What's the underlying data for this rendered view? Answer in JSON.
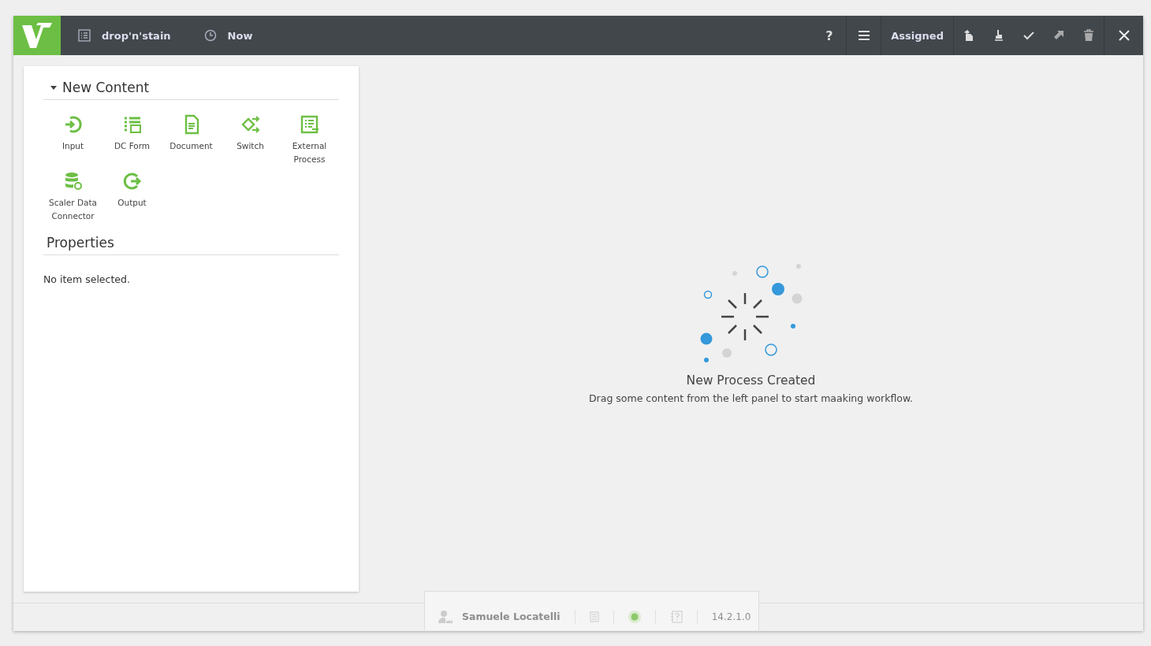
{
  "top_bar": {
    "process_name": "drop'n'stain",
    "time": "Now",
    "help": "?",
    "assignment": "Assigned"
  },
  "new_content": {
    "title": "New Content",
    "expanded": true,
    "items": [
      {
        "label": "Input"
      },
      {
        "label": "DC Form"
      },
      {
        "label": "Document"
      },
      {
        "label": "Switch"
      },
      {
        "label": "External Process"
      },
      {
        "label": "Scaler Data Connector"
      },
      {
        "label": "Output"
      }
    ]
  },
  "properties": {
    "title": "Properties",
    "message": "No item selected."
  },
  "canvas": {
    "title": "New Process Created",
    "message": "Drag some content from the left panel to start maaking workflow."
  },
  "status_bar": {
    "user": "Samuele Locatelli",
    "version": "14.2.1.0"
  }
}
